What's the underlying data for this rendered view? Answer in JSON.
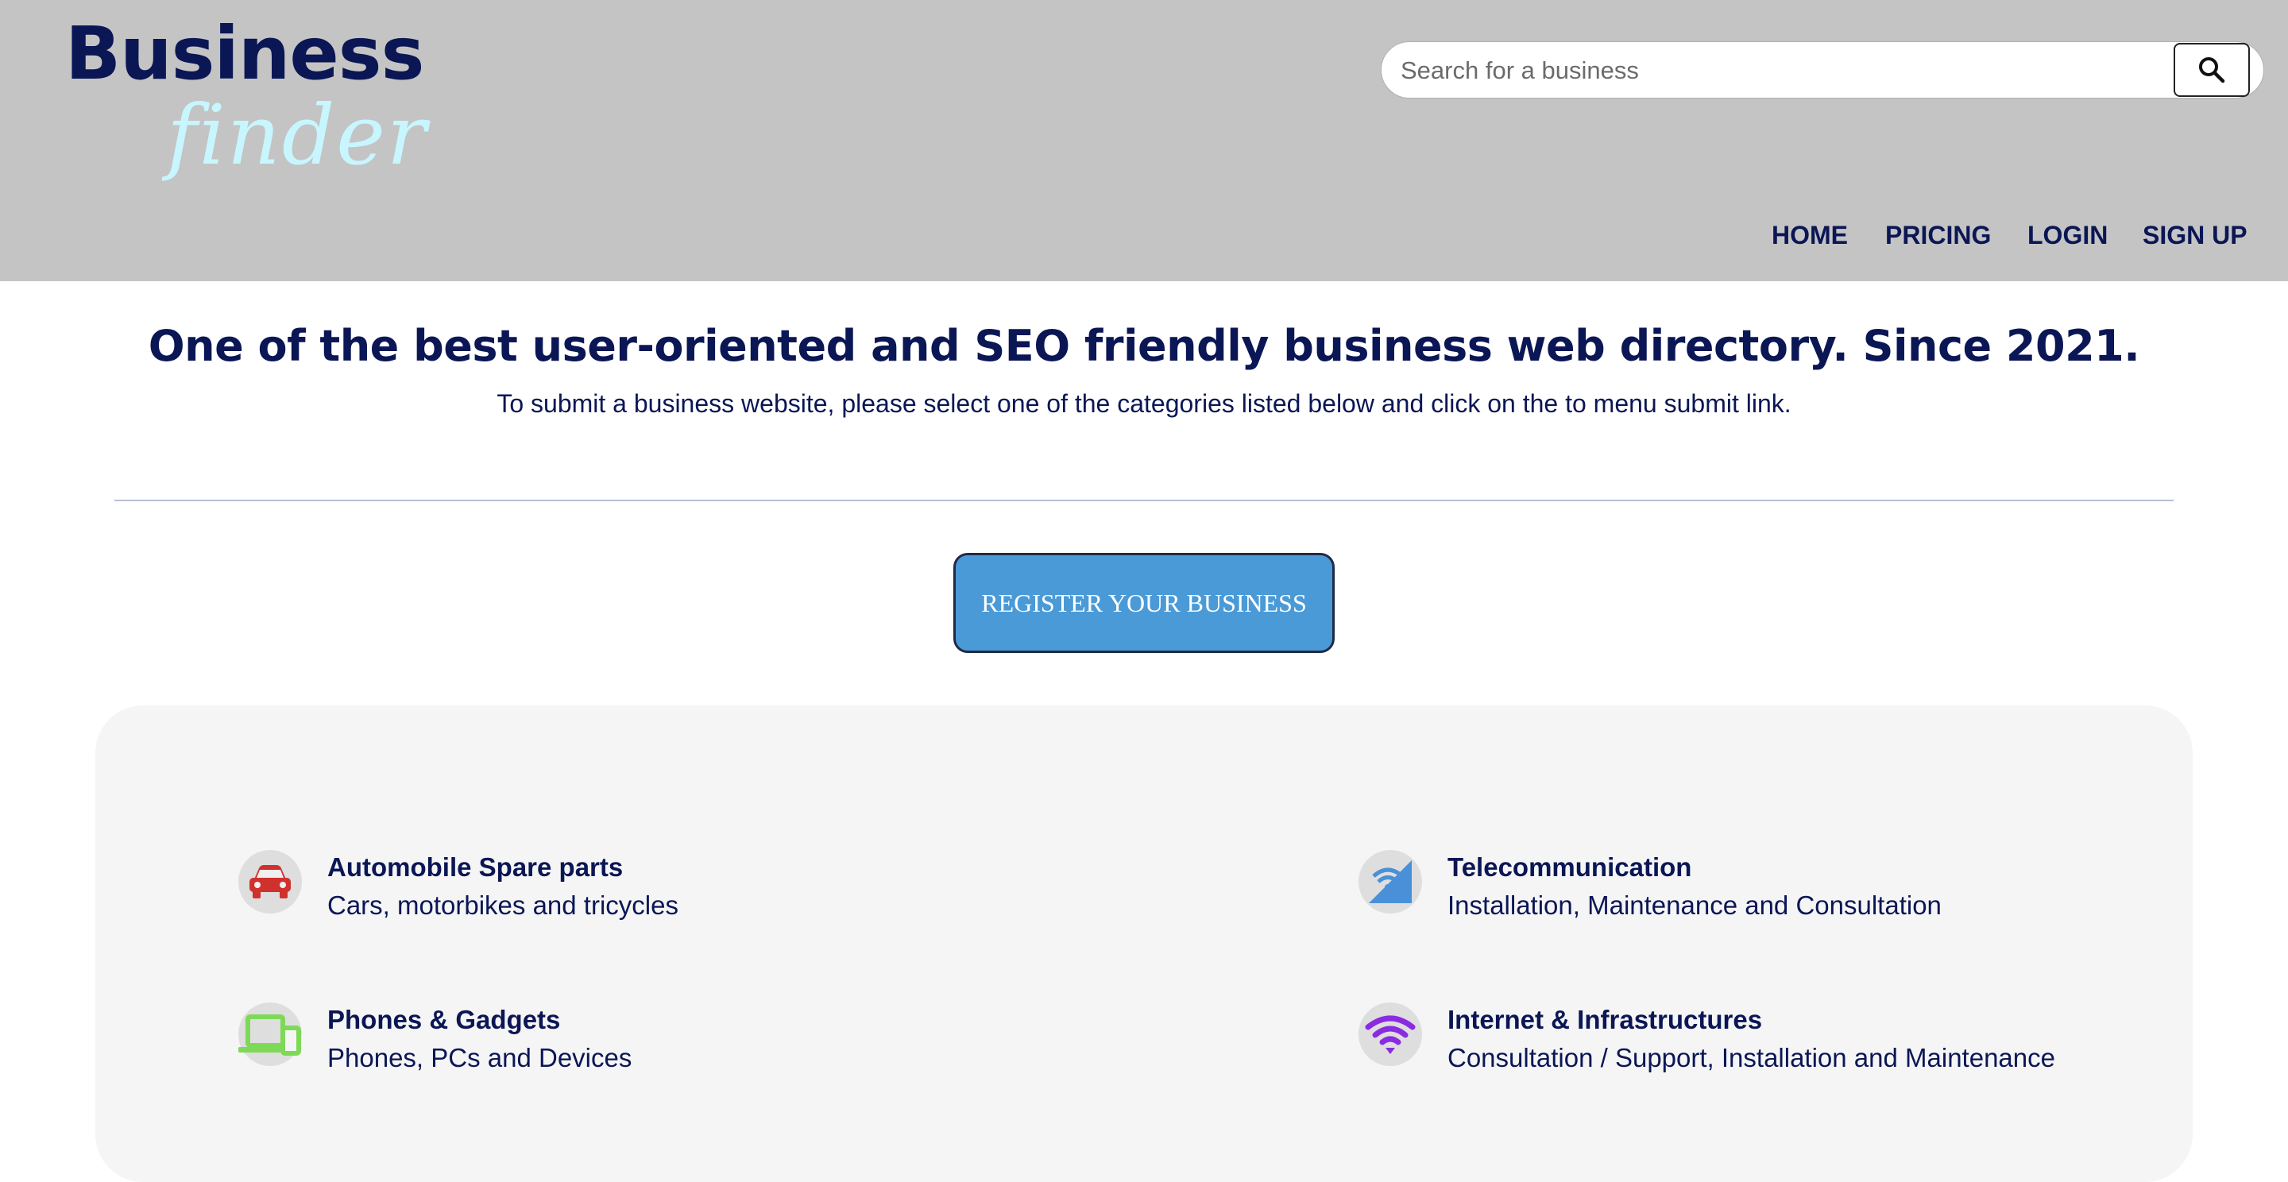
{
  "logo": {
    "line1": "Business",
    "line2": "finder"
  },
  "search": {
    "placeholder": "Search for a business"
  },
  "nav": {
    "home": "HOME",
    "pricing": "PRICING",
    "login": "LOGIN",
    "signup": "SIGN UP"
  },
  "hero": {
    "headline": "One of the best user-oriented and SEO friendly business web directory. Since 2021.",
    "subline": "To submit a business website, please select one of the categories listed below and click on the to menu submit link."
  },
  "register_button": "REGISTER YOUR BUSINESS",
  "categories": [
    {
      "title": "Automobile Spare parts",
      "desc": "Cars, motorbikes and tricycles",
      "icon": "car-icon",
      "color": "#d0312d"
    },
    {
      "title": "Telecommunication",
      "desc": "Installation, Maintenance and Consultation",
      "icon": "signal-icon",
      "color": "#4a90d9"
    },
    {
      "title": "Phones & Gadgets",
      "desc": "Phones, PCs and Devices",
      "icon": "devices-icon",
      "color": "#7ed957"
    },
    {
      "title": "Internet & Infrastructures",
      "desc": "Consultation / Support, Installation and Maintenance",
      "icon": "wifi-icon",
      "color": "#8a2be2"
    }
  ],
  "colors": {
    "header_bg": "#c4c4c4",
    "brand_navy": "#0b1655",
    "logo_script": "#c8f6ff",
    "register_bg": "#4a9ad8",
    "panel_bg": "#f5f5f5"
  }
}
